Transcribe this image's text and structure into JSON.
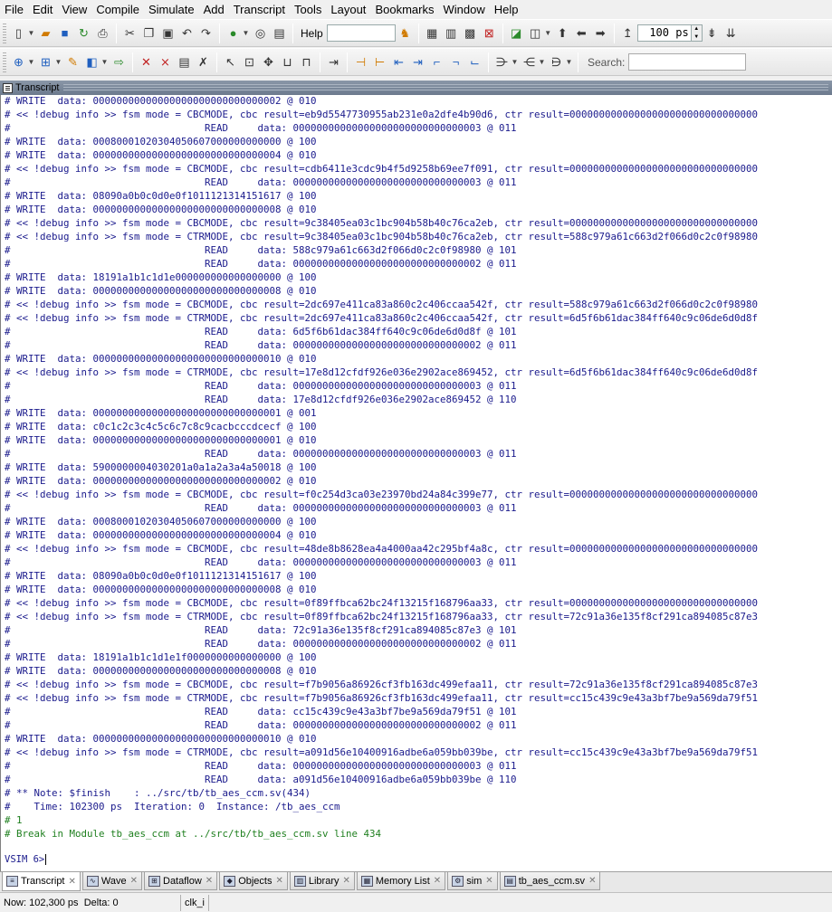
{
  "menu": [
    "File",
    "Edit",
    "View",
    "Compile",
    "Simulate",
    "Add",
    "Transcript",
    "Tools",
    "Layout",
    "Bookmarks",
    "Window",
    "Help"
  ],
  "toolbar": {
    "help_label": "Help",
    "help_value": "",
    "run_length": "100 ps",
    "search_label": "Search:",
    "search_value": ""
  },
  "pane": {
    "title": "Transcript"
  },
  "transcript": {
    "lines": [
      {
        "text": "# WRITE  data: 00000000000000000000000000000002 @ 010",
        "color": "blue"
      },
      {
        "text": "# << !debug info >> fsm mode = CBCMODE, cbc result=eb9d5547730955ab231e0a2dfe4b90d6, ctr result=00000000000000000000000000000000",
        "color": "blue"
      },
      {
        "text": "#                                 READ     data: 00000000000000000000000000000003 @ 011",
        "color": "blue"
      },
      {
        "text": "# WRITE  data: 00080001020304050607000000000000 @ 100",
        "color": "blue"
      },
      {
        "text": "# WRITE  data: 00000000000000000000000000000004 @ 010",
        "color": "blue"
      },
      {
        "text": "# << !debug info >> fsm mode = CBCMODE, cbc result=cdb6411e3cdc9b4f5d9258b69ee7f091, ctr result=00000000000000000000000000000000",
        "color": "blue"
      },
      {
        "text": "#                                 READ     data: 00000000000000000000000000000003 @ 011",
        "color": "blue"
      },
      {
        "text": "# WRITE  data: 08090a0b0c0d0e0f1011121314151617 @ 100",
        "color": "blue"
      },
      {
        "text": "# WRITE  data: 00000000000000000000000000000008 @ 010",
        "color": "blue"
      },
      {
        "text": "# << !debug info >> fsm mode = CBCMODE, cbc result=9c38405ea03c1bc904b58b40c76ca2eb, ctr result=00000000000000000000000000000000",
        "color": "blue"
      },
      {
        "text": "# << !debug info >> fsm mode = CTRMODE, cbc result=9c38405ea03c1bc904b58b40c76ca2eb, ctr result=588c979a61c663d2f066d0c2c0f98980",
        "color": "blue"
      },
      {
        "text": "#                                 READ     data: 588c979a61c663d2f066d0c2c0f98980 @ 101",
        "color": "blue"
      },
      {
        "text": "#                                 READ     data: 00000000000000000000000000000002 @ 011",
        "color": "blue"
      },
      {
        "text": "# WRITE  data: 18191a1b1c1d1e000000000000000000 @ 100",
        "color": "blue"
      },
      {
        "text": "# WRITE  data: 00000000000000000000000000000008 @ 010",
        "color": "blue"
      },
      {
        "text": "# << !debug info >> fsm mode = CBCMODE, cbc result=2dc697e411ca83a860c2c406ccaa542f, ctr result=588c979a61c663d2f066d0c2c0f98980",
        "color": "blue"
      },
      {
        "text": "# << !debug info >> fsm mode = CTRMODE, cbc result=2dc697e411ca83a860c2c406ccaa542f, ctr result=6d5f6b61dac384ff640c9c06de6d0d8f",
        "color": "blue"
      },
      {
        "text": "#                                 READ     data: 6d5f6b61dac384ff640c9c06de6d0d8f @ 101",
        "color": "blue"
      },
      {
        "text": "#                                 READ     data: 00000000000000000000000000000002 @ 011",
        "color": "blue"
      },
      {
        "text": "# WRITE  data: 00000000000000000000000000000010 @ 010",
        "color": "blue"
      },
      {
        "text": "# << !debug info >> fsm mode = CTRMODE, cbc result=17e8d12cfdf926e036e2902ace869452, ctr result=6d5f6b61dac384ff640c9c06de6d0d8f",
        "color": "blue"
      },
      {
        "text": "#                                 READ     data: 00000000000000000000000000000003 @ 011",
        "color": "blue"
      },
      {
        "text": "#                                 READ     data: 17e8d12cfdf926e036e2902ace869452 @ 110",
        "color": "blue"
      },
      {
        "text": "# WRITE  data: 00000000000000000000000000000001 @ 001",
        "color": "blue"
      },
      {
        "text": "# WRITE  data: c0c1c2c3c4c5c6c7c8c9cacbcccdcecf @ 100",
        "color": "blue"
      },
      {
        "text": "# WRITE  data: 00000000000000000000000000000001 @ 010",
        "color": "blue"
      },
      {
        "text": "#                                 READ     data: 00000000000000000000000000000003 @ 011",
        "color": "blue"
      },
      {
        "text": "# WRITE  data: 5900000004030201a0a1a2a3a4a50018 @ 100",
        "color": "blue"
      },
      {
        "text": "# WRITE  data: 00000000000000000000000000000002 @ 010",
        "color": "blue"
      },
      {
        "text": "# << !debug info >> fsm mode = CBCMODE, cbc result=f0c254d3ca03e23970bd24a84c399e77, ctr result=00000000000000000000000000000000",
        "color": "blue"
      },
      {
        "text": "#                                 READ     data: 00000000000000000000000000000003 @ 011",
        "color": "blue"
      },
      {
        "text": "# WRITE  data: 00080001020304050607000000000000 @ 100",
        "color": "blue"
      },
      {
        "text": "# WRITE  data: 00000000000000000000000000000004 @ 010",
        "color": "blue"
      },
      {
        "text": "# << !debug info >> fsm mode = CBCMODE, cbc result=48de8b8628ea4a4000aa42c295bf4a8c, ctr result=00000000000000000000000000000000",
        "color": "blue"
      },
      {
        "text": "#                                 READ     data: 00000000000000000000000000000003 @ 011",
        "color": "blue"
      },
      {
        "text": "# WRITE  data: 08090a0b0c0d0e0f1011121314151617 @ 100",
        "color": "blue"
      },
      {
        "text": "# WRITE  data: 00000000000000000000000000000008 @ 010",
        "color": "blue"
      },
      {
        "text": "# << !debug info >> fsm mode = CBCMODE, cbc result=0f89ffbca62bc24f13215f168796aa33, ctr result=00000000000000000000000000000000",
        "color": "blue"
      },
      {
        "text": "# << !debug info >> fsm mode = CTRMODE, cbc result=0f89ffbca62bc24f13215f168796aa33, ctr result=72c91a36e135f8cf291ca894085c87e3",
        "color": "blue"
      },
      {
        "text": "#                                 READ     data: 72c91a36e135f8cf291ca894085c87e3 @ 101",
        "color": "blue"
      },
      {
        "text": "#                                 READ     data: 00000000000000000000000000000002 @ 011",
        "color": "blue"
      },
      {
        "text": "# WRITE  data: 18191a1b1c1d1e1f0000000000000000 @ 100",
        "color": "blue"
      },
      {
        "text": "# WRITE  data: 00000000000000000000000000000008 @ 010",
        "color": "blue"
      },
      {
        "text": "# << !debug info >> fsm mode = CBCMODE, cbc result=f7b9056a86926cf3fb163dc499efaa11, ctr result=72c91a36e135f8cf291ca894085c87e3",
        "color": "blue"
      },
      {
        "text": "# << !debug info >> fsm mode = CTRMODE, cbc result=f7b9056a86926cf3fb163dc499efaa11, ctr result=cc15c439c9e43a3bf7be9a569da79f51",
        "color": "blue"
      },
      {
        "text": "#                                 READ     data: cc15c439c9e43a3bf7be9a569da79f51 @ 101",
        "color": "blue"
      },
      {
        "text": "#                                 READ     data: 00000000000000000000000000000002 @ 011",
        "color": "blue"
      },
      {
        "text": "# WRITE  data: 00000000000000000000000000000010 @ 010",
        "color": "blue"
      },
      {
        "text": "# << !debug info >> fsm mode = CTRMODE, cbc result=a091d56e10400916adbe6a059bb039be, ctr result=cc15c439c9e43a3bf7be9a569da79f51",
        "color": "blue"
      },
      {
        "text": "#                                 READ     data: 00000000000000000000000000000003 @ 011",
        "color": "blue"
      },
      {
        "text": "#                                 READ     data: a091d56e10400916adbe6a059bb039be @ 110",
        "color": "blue"
      },
      {
        "text": "# ** Note: $finish    : ../src/tb/tb_aes_ccm.sv(434)",
        "color": "blue"
      },
      {
        "text": "#    Time: 102300 ps  Iteration: 0  Instance: /tb_aes_ccm",
        "color": "blue"
      },
      {
        "text": "# 1",
        "color": "green"
      },
      {
        "text": "# Break in Module tb_aes_ccm at ../src/tb/tb_aes_ccm.sv line 434",
        "color": "green"
      }
    ],
    "prompt": "VSIM 6>"
  },
  "tabs": [
    {
      "label": "Transcript",
      "icon": "transcript-icon",
      "active": true
    },
    {
      "label": "Wave",
      "icon": "wave-icon",
      "active": false
    },
    {
      "label": "Dataflow",
      "icon": "dataflow-icon",
      "active": false
    },
    {
      "label": "Objects",
      "icon": "objects-icon",
      "active": false
    },
    {
      "label": "Library",
      "icon": "library-icon",
      "active": false
    },
    {
      "label": "Memory List",
      "icon": "memory-list-icon",
      "active": false
    },
    {
      "label": "sim",
      "icon": "sim-icon",
      "active": false
    },
    {
      "label": "tb_aes_ccm.sv",
      "icon": "source-file-icon",
      "active": false
    }
  ],
  "status": {
    "now": "Now: 102,300 ps",
    "delta": "Delta: 0",
    "signal": "clk_i"
  },
  "colors": {
    "transcript_text": "#1a1a8c",
    "transcript_green": "#208020",
    "pane_header": "#6c7a8d"
  }
}
